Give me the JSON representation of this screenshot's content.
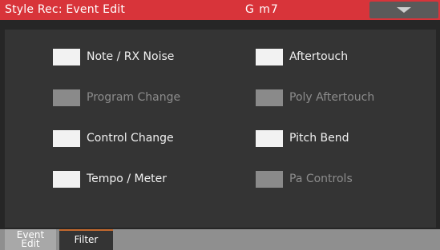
{
  "titlebar": {
    "title": "Style Rec: Event Edit",
    "chord": "G m7",
    "menu_icon": "chevron-down-icon"
  },
  "filters": [
    {
      "label": "Note / RX Noise",
      "enabled": true
    },
    {
      "label": "Aftertouch",
      "enabled": true
    },
    {
      "label": "Program Change",
      "enabled": false
    },
    {
      "label": "Poly Aftertouch",
      "enabled": false
    },
    {
      "label": "Control Change",
      "enabled": true
    },
    {
      "label": "Pitch Bend",
      "enabled": true
    },
    {
      "label": "Tempo / Meter",
      "enabled": true
    },
    {
      "label": "Pa Controls",
      "enabled": false
    }
  ],
  "tabs": {
    "event_edit_line1": "Event",
    "event_edit_line2": "Edit",
    "filter": "Filter",
    "active": "Filter"
  },
  "colors": {
    "titlebar": "#d8343a",
    "background": "#262626",
    "panel": "#343434",
    "active_tab_accent": "#c66a2e"
  }
}
